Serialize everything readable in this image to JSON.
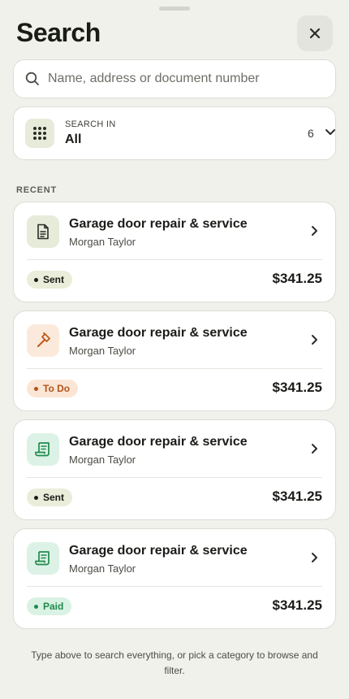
{
  "header": {
    "title": "Search",
    "close_icon": "close-icon"
  },
  "search": {
    "placeholder": "Name, address or document number",
    "value": ""
  },
  "scope": {
    "caption": "SEARCH IN",
    "value": "All",
    "count": "6"
  },
  "recent": {
    "label": "RECENT",
    "items": [
      {
        "title": "Garage door repair & service",
        "subtitle": "Morgan Taylor",
        "status": "Sent",
        "amount": "$341.25",
        "icon": "document-icon"
      },
      {
        "title": "Garage door repair & service",
        "subtitle": "Morgan Taylor",
        "status": "To Do",
        "amount": "$341.25",
        "icon": "hammer-icon"
      },
      {
        "title": "Garage door repair & service",
        "subtitle": "Morgan Taylor",
        "status": "Sent",
        "amount": "$341.25",
        "icon": "invoice-icon"
      },
      {
        "title": "Garage door repair & service",
        "subtitle": "Morgan Taylor",
        "status": "Paid",
        "amount": "$341.25",
        "icon": "invoice-icon"
      }
    ]
  },
  "footer": {
    "hint": "Type above to search everything, or pick a category to browse and filter."
  },
  "colors": {
    "background": "#f1f1ec",
    "sent_badge": "#eaedd9",
    "todo_badge": "#fbe6d6",
    "todo_text": "#b3541a",
    "paid_badge": "#d9f2e3",
    "paid_text": "#1f8a4c",
    "doc_icon_bg": "#e7ebd9",
    "job_icon_bg": "#fbeadc",
    "invoice_icon_bg": "#ddf2e6"
  }
}
